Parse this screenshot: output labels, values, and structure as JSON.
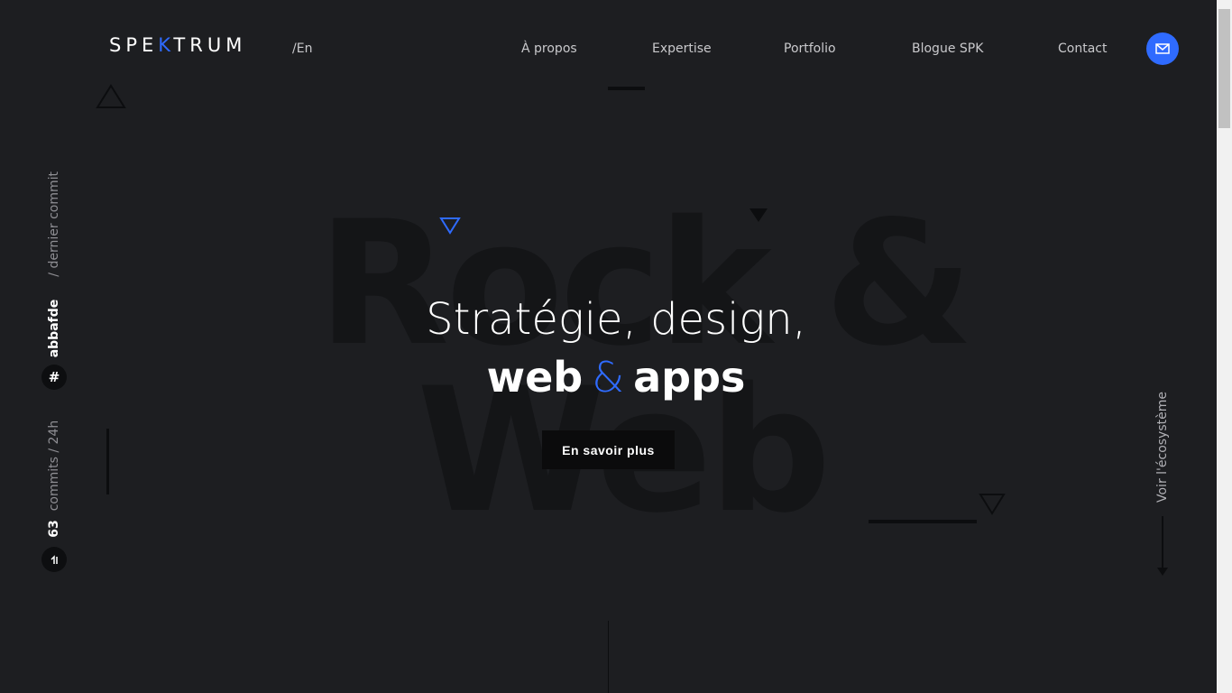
{
  "header": {
    "logo": {
      "prefix": "SPE",
      "accent": "K",
      "suffix": "TRUM"
    },
    "lang_switch": "/En",
    "nav": [
      {
        "label": "À propos"
      },
      {
        "label": "Expertise"
      },
      {
        "label": "Portfolio"
      },
      {
        "label": "Blogue SPK"
      },
      {
        "label": "Contact"
      }
    ],
    "mail_icon": "envelope-icon"
  },
  "background_words": {
    "line1": "Rock &",
    "line2": "Web"
  },
  "hero": {
    "line1": "Stratégie, design,",
    "line2_part1": "web",
    "line2_amp": "&",
    "line2_part2": "apps",
    "cta_label": "En savoir plus"
  },
  "commit_info": {
    "hash_icon": "#",
    "hash": "abbafde",
    "hash_caption": "/ dernier commit",
    "count_icon": "commit-icon",
    "count": "63",
    "count_caption": "commits / 24h"
  },
  "ecosystem_link": "Voir l'écosystème",
  "colors": {
    "background": "#1d1e21",
    "accent": "#2f6bff",
    "text": "#ffffff",
    "nav_text": "#c9c9cc",
    "bg_word": "#141517"
  }
}
